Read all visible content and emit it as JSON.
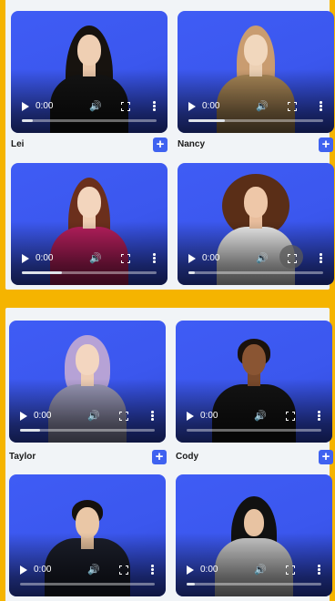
{
  "top_panel": {
    "cards": [
      {
        "time": "0:00",
        "progress": 0.08
      },
      {
        "time": "0:00",
        "progress": 0.27
      },
      {
        "time": "0:00",
        "progress": 0.3
      },
      {
        "time": "0:00",
        "progress": 0.05
      }
    ],
    "labels": [
      "Lei",
      "Nancy"
    ]
  },
  "bottom_panel": {
    "cards": [
      {
        "time": "0:00",
        "progress": 0.15
      },
      {
        "time": "0:00",
        "progress": 0.0
      },
      {
        "time": "0:00",
        "progress": 0.0
      },
      {
        "time": "0:00",
        "progress": 0.06
      }
    ],
    "labels": [
      "Taylor",
      "Cody"
    ]
  },
  "add_label": "+",
  "colors": {
    "accent": "#3f62f0",
    "background": "#f5b400",
    "card_bg": "#3f5cf5"
  }
}
